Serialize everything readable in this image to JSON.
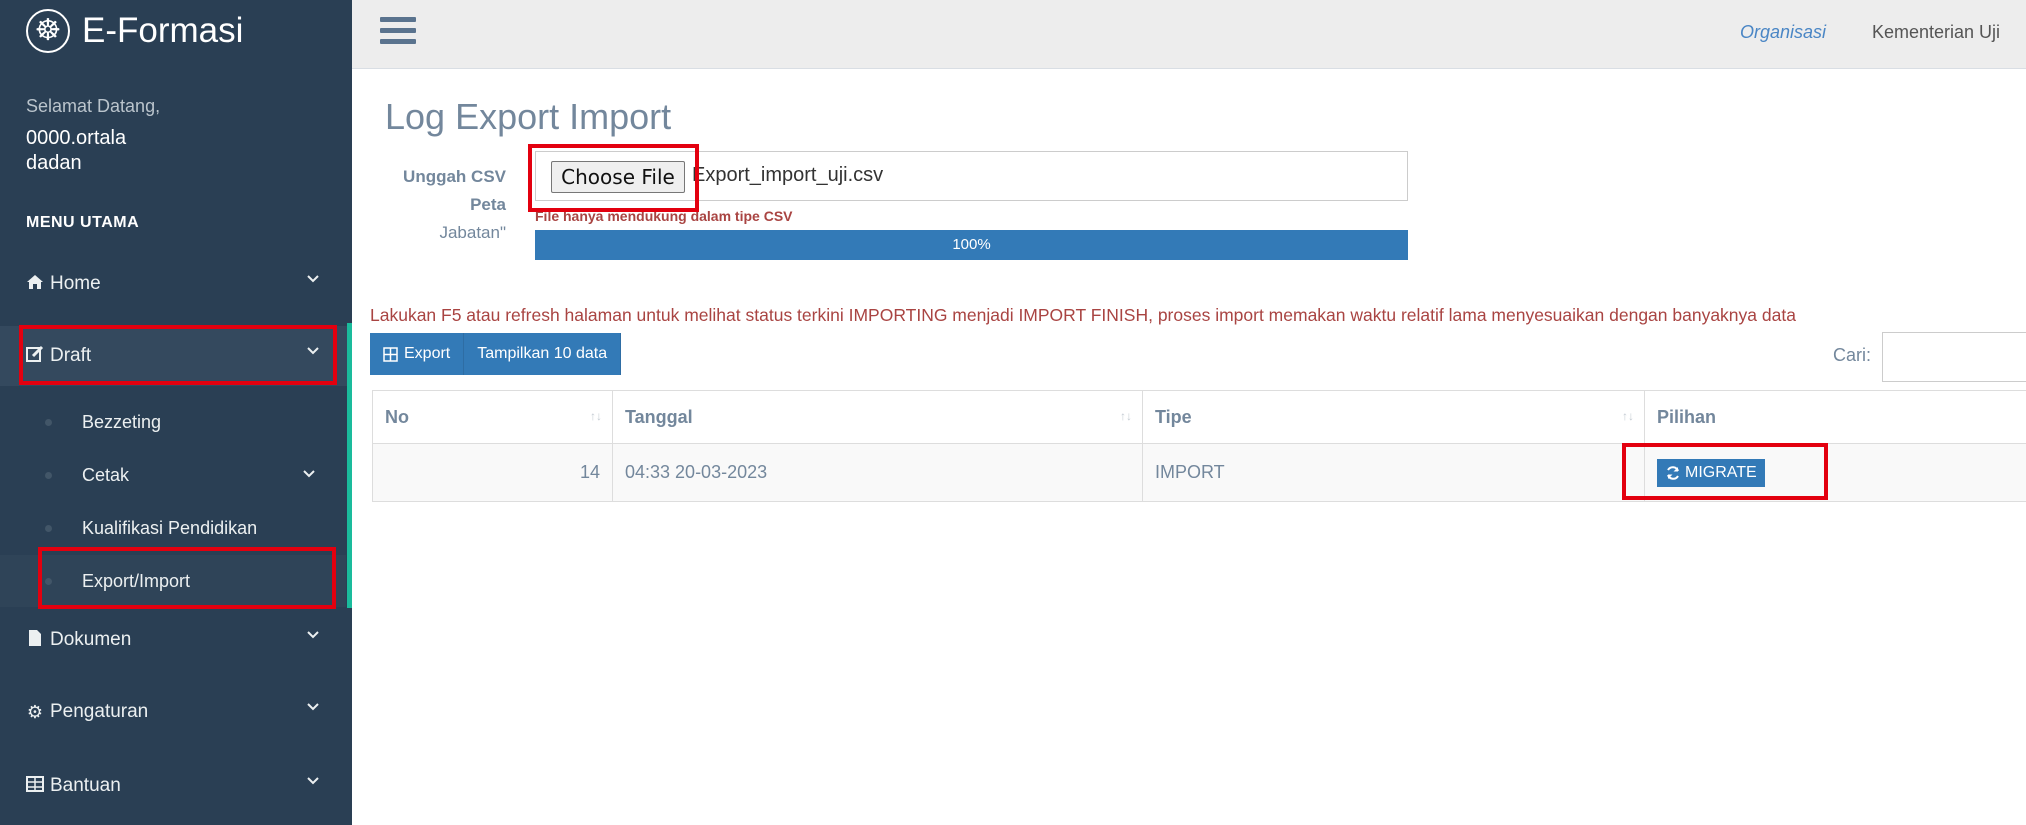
{
  "brand": {
    "title": "E-Formasi",
    "logo_icon": "dharma-wheel-icon"
  },
  "user": {
    "welcome": "Selamat Datang,",
    "line1": "0000.ortala",
    "line2": "dadan"
  },
  "sidebar": {
    "heading": "MENU UTAMA",
    "items": [
      {
        "label": "Home",
        "icon": "home-icon"
      },
      {
        "label": "Draft",
        "icon": "edit-icon"
      },
      {
        "label": "Dokumen",
        "icon": "file-icon"
      },
      {
        "label": "Pengaturan",
        "icon": "cogs-icon"
      },
      {
        "label": "Bantuan",
        "icon": "table-icon"
      }
    ],
    "sub_items": [
      {
        "label": "Bezzeting"
      },
      {
        "label": "Cetak"
      },
      {
        "label": "Kualifikasi Pendidikan"
      },
      {
        "label": "Export/Import"
      }
    ]
  },
  "topbar": {
    "org_label": "Organisasi",
    "org_value": "Kementerian Uji"
  },
  "page": {
    "title": "Log Export Import",
    "upload_label_1": "Unggah CSV",
    "upload_label_2": "Peta",
    "upload_label_3": "Jabatan\"",
    "choose_file": "Choose File",
    "file_name": "Export_import_uji.csv",
    "hint": "File hanya mendukung dalam tipe CSV",
    "progress_text": "100%",
    "progress_value": 100,
    "notice": "Lakukan F5 atau refresh halaman untuk melihat status terkini IMPORTING menjadi IMPORT FINISH, proses import memakan waktu relatif lama menyesuaikan dengan banyaknya data",
    "export_btn": "Export",
    "show_btn": "Tampilkan 10 data",
    "search_label": "Cari:"
  },
  "table": {
    "headers": [
      "No",
      "Tanggal",
      "Tipe",
      "Pilihan"
    ],
    "rows": [
      {
        "no": "14",
        "tanggal": "04:33 20-03-2023",
        "tipe": "IMPORT",
        "action": "MIGRATE"
      }
    ]
  },
  "colors": {
    "sidebar": "#2a3f54",
    "accent": "#337ab7",
    "highlight": "#e3000f",
    "active_bar": "#1abb9c"
  }
}
